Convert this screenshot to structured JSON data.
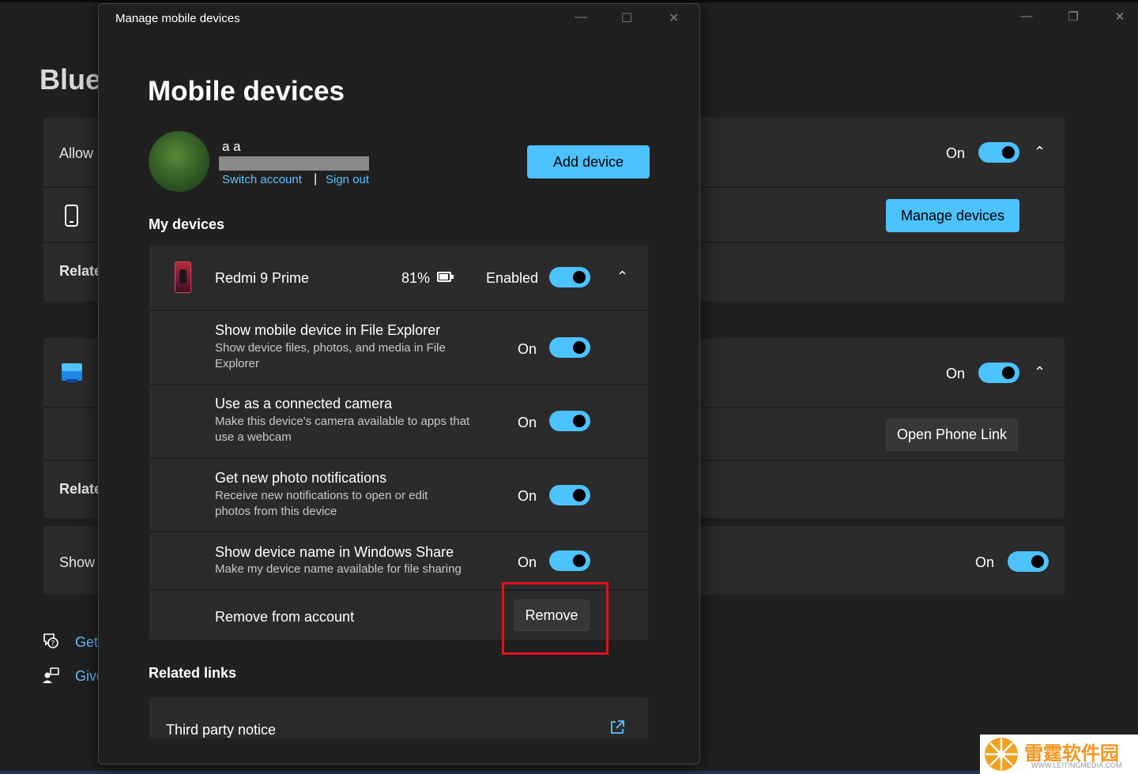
{
  "background_window": {
    "title_partial": "Bluet",
    "caption_buttons": [
      "minimize",
      "restore",
      "close"
    ],
    "card1": {
      "row1_label": "Allow",
      "row1_state": "On",
      "manage_button": "Manage devices",
      "related_label": "Relate"
    },
    "card2": {
      "row1_state": "On",
      "open_phone_link_button": "Open Phone Link",
      "related_label": "Relate"
    },
    "card3": {
      "show_label": "Show",
      "show_state": "On"
    },
    "links": {
      "get_help": "Get",
      "give_feedback": "Give"
    }
  },
  "dialog": {
    "window_title": "Manage mobile devices",
    "heading": "Mobile devices",
    "account": {
      "name": "a a",
      "switch_account": "Switch account",
      "separator": "|",
      "sign_out": "Sign out"
    },
    "add_device_button": "Add device",
    "my_devices_title": "My devices",
    "device": {
      "name": "Redmi 9 Prime",
      "battery": "81%",
      "status": "Enabled"
    },
    "settings": [
      {
        "title": "Show mobile device in File Explorer",
        "subtitle_line1": "Show device files, photos, and media in File",
        "subtitle_line2": "Explorer",
        "state": "On"
      },
      {
        "title": "Use as a connected camera",
        "subtitle_line1": "Make this device's camera available to apps that",
        "subtitle_line2": "use a webcam",
        "state": "On"
      },
      {
        "title": "Get new photo notifications",
        "subtitle_line1": "Receive new notifications to open or edit",
        "subtitle_line2": "photos from this device",
        "state": "On"
      },
      {
        "title": "Show device name in Windows Share",
        "subtitle_line1": "Make my device name available for file sharing",
        "subtitle_line2": "",
        "state": "On"
      }
    ],
    "remove_row": {
      "label": "Remove from account",
      "button": "Remove"
    },
    "related_links_title": "Related links",
    "third_party_notice": "Third party notice"
  },
  "watermark": {
    "text": "雷霆软件园",
    "url": "WWW.LEITINGMEDIA.COM"
  },
  "colors": {
    "accent": "#4cc2ff",
    "highlight_box": "#e1111f",
    "card": "#2b2b2b",
    "background": "#202020"
  }
}
